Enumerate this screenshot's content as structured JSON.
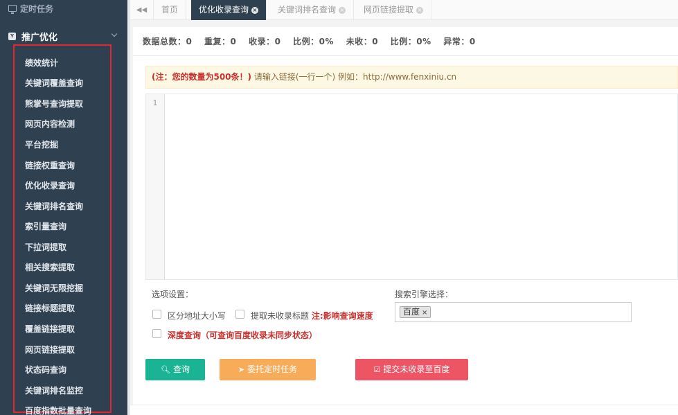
{
  "sidebar": {
    "top_item": "定时任务",
    "group_badge": "Y",
    "group_title": "推广优化",
    "items": [
      "绩效统计",
      "关键词覆盖查询",
      "熊掌号查询提取",
      "网页内容检测",
      "平台挖掘",
      "链接权重查询",
      "优化收录查询",
      "关键词排名查询",
      "索引量查询",
      "下拉词提取",
      "相关搜索提取",
      "关键词无限挖掘",
      "链接标题提取",
      "覆盖链接提取",
      "网页链接提取",
      "状态码查询",
      "关键词排名监控",
      "百度指数批量查询"
    ]
  },
  "tabs": {
    "home": "首页",
    "items": [
      "优化收录查询",
      "关键词排名查询",
      "网页链接提取"
    ]
  },
  "stats": {
    "total": "数据总数：0",
    "dup": "重复：0",
    "indexed": "收录：0",
    "ratio1": "比例：0%",
    "not_indexed": "未收：0",
    "ratio2": "比例：0%",
    "error": "异常：0"
  },
  "notice": {
    "strong": "(注：您的数量为500条！)",
    "text": "请输入链接(一行一个)   例如：http://www.fenxiniu.cn"
  },
  "editor": {
    "line_number": "1"
  },
  "options": {
    "label": "选项设置：",
    "case_sensitive": "区分地址大小写",
    "fetch_title": "提取未收录标题",
    "fetch_title_note": "注:影响查询速度",
    "deep_query": "深度查询（可查询百度收录未同步状态）"
  },
  "engine": {
    "label": "搜索引擎选择：",
    "selected": "百度",
    "remove": "×"
  },
  "buttons": {
    "query": "查询",
    "task": "委托定时任务",
    "submit": "提交未收录至百度"
  },
  "colors": {
    "sidebar_bg": "#2f4050",
    "primary": "#1ab394",
    "warning": "#f8ac59",
    "danger": "#ed5565",
    "highlight_border": "#e8242e"
  }
}
